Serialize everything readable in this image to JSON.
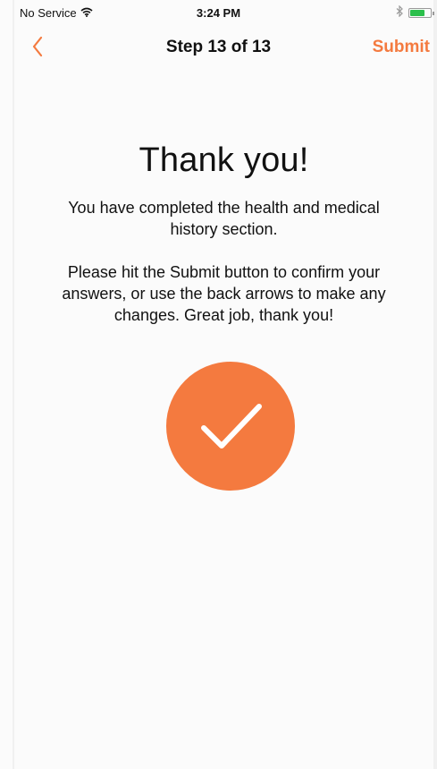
{
  "status_bar": {
    "carrier": "No Service",
    "time": "3:24 PM"
  },
  "nav": {
    "title": "Step 13 of 13",
    "submit_label": "Submit"
  },
  "content": {
    "heading": "Thank you!",
    "paragraph1": "You have completed the health and medical history section.",
    "paragraph2": "Please hit the Submit button to confirm your answers, or use the back arrows to make any changes. Great job, thank you!"
  },
  "icons": {
    "back": "chevron-left-icon",
    "wifi": "wifi-icon",
    "bluetooth": "bluetooth-icon",
    "battery": "battery-icon",
    "completion": "checkmark-icon"
  },
  "colors": {
    "accent": "#f47a3f",
    "battery": "#2bbf4b"
  }
}
